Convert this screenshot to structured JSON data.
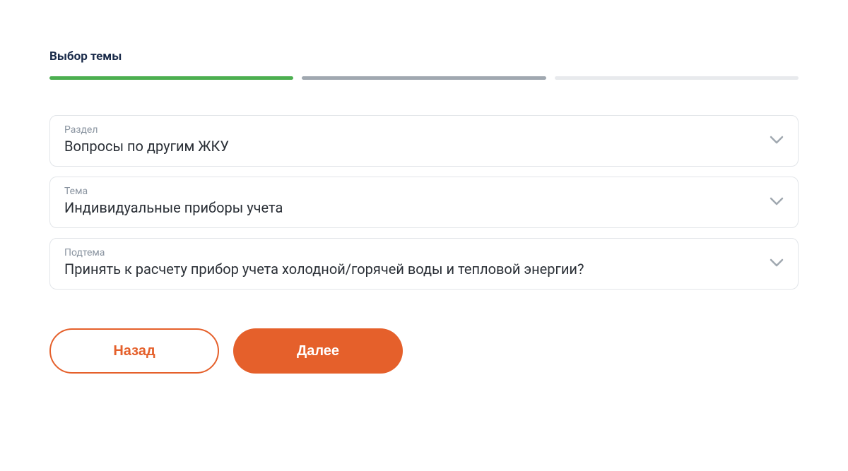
{
  "step": {
    "title": "Выбор темы"
  },
  "fields": {
    "section": {
      "label": "Раздел",
      "value": "Вопросы по другим ЖКУ"
    },
    "topic": {
      "label": "Тема",
      "value": "Индивидуальные приборы учета"
    },
    "subtopic": {
      "label": "Подтема",
      "value": "Принять к расчету прибор учета холодной/горячей воды и тепловой энергии?"
    }
  },
  "buttons": {
    "back": "Назад",
    "next": "Далее"
  }
}
